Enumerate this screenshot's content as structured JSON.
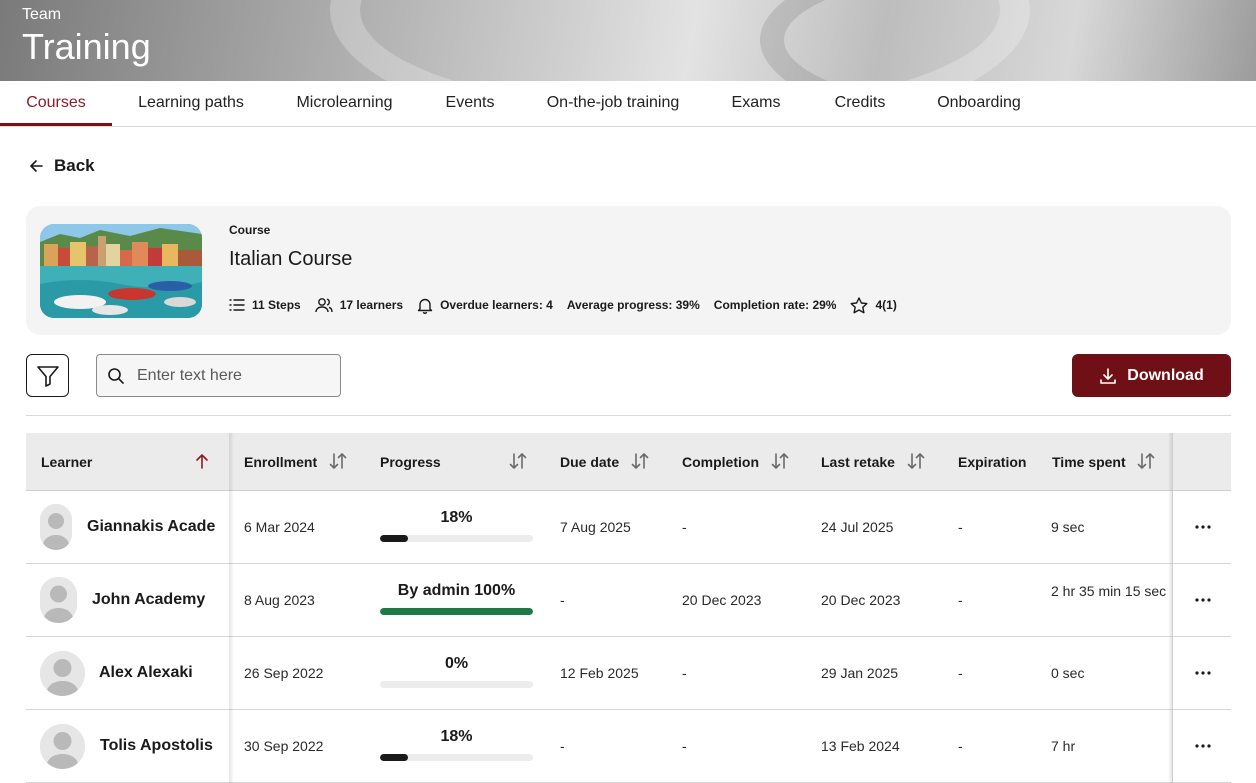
{
  "banner": {
    "subtitle": "Team",
    "title": "Training"
  },
  "tabs": [
    {
      "label": "Courses",
      "active": true
    },
    {
      "label": "Learning paths"
    },
    {
      "label": "Microlearning"
    },
    {
      "label": "Events"
    },
    {
      "label": "On-the-job training"
    },
    {
      "label": "Exams"
    },
    {
      "label": "Credits"
    },
    {
      "label": "Onboarding"
    }
  ],
  "back_label": "Back",
  "course": {
    "kicker": "Course",
    "title": "Italian Course",
    "stats": {
      "steps": "11 Steps",
      "learners": "17 learners",
      "overdue": "Overdue learners: 4",
      "avg_progress": "Average progress: 39%",
      "completion_rate": "Completion rate: 29%",
      "rating": "4(1)"
    }
  },
  "search": {
    "placeholder": "Enter text here",
    "value": ""
  },
  "download_label": "Download",
  "table": {
    "headers": {
      "learner": "Learner",
      "enrollment": "Enrollment",
      "progress": "Progress",
      "due_date": "Due date",
      "completion": "Completion",
      "last_retake": "Last retake",
      "expiration": "Expiration",
      "time_spent": "Time spent"
    },
    "rows": [
      {
        "name": "Giannakis Academy",
        "enrollment": "6 Mar 2024",
        "progress_label": "18%",
        "progress": 0.18,
        "progress_color": "#1a1a1a",
        "due_date": "7 Aug 2025",
        "completion": "-",
        "last_retake": "24 Jul 2025",
        "expiration": "-",
        "time_spent": "9 sec"
      },
      {
        "name": "John Academy",
        "enrollment": "8 Aug 2023",
        "progress_label": "By admin 100%",
        "progress": 1.0,
        "progress_color": "#1e7a45",
        "due_date": "-",
        "completion": "20 Dec 2023",
        "last_retake": "20 Dec 2023",
        "expiration": "-",
        "time_spent": "2 hr 35 min 15 sec"
      },
      {
        "name": "Alex Alexaki",
        "enrollment": "26 Sep 2022",
        "progress_label": "0%",
        "progress": 0.0,
        "progress_color": "#1a1a1a",
        "due_date": "12 Feb 2025",
        "completion": "-",
        "last_retake": "29 Jan 2025",
        "expiration": "-",
        "time_spent": "0 sec"
      },
      {
        "name": "Tolis Apostolis",
        "enrollment": "30 Sep 2022",
        "progress_label": "18%",
        "progress": 0.18,
        "progress_color": "#1a1a1a",
        "due_date": "-",
        "completion": "-",
        "last_retake": "13 Feb 2024",
        "expiration": "-",
        "time_spent": "7 hr"
      }
    ]
  },
  "colors": {
    "accent": "#7b1017",
    "download_bg": "#6e1016",
    "complete_green": "#1e7a45"
  },
  "icons": [
    "arrow-left-icon",
    "list-icon",
    "users-icon",
    "bell-icon",
    "star-icon",
    "filter-icon",
    "search-icon",
    "download-icon",
    "sort-icon",
    "sort-up-icon",
    "more-icon",
    "avatar-icon"
  ]
}
